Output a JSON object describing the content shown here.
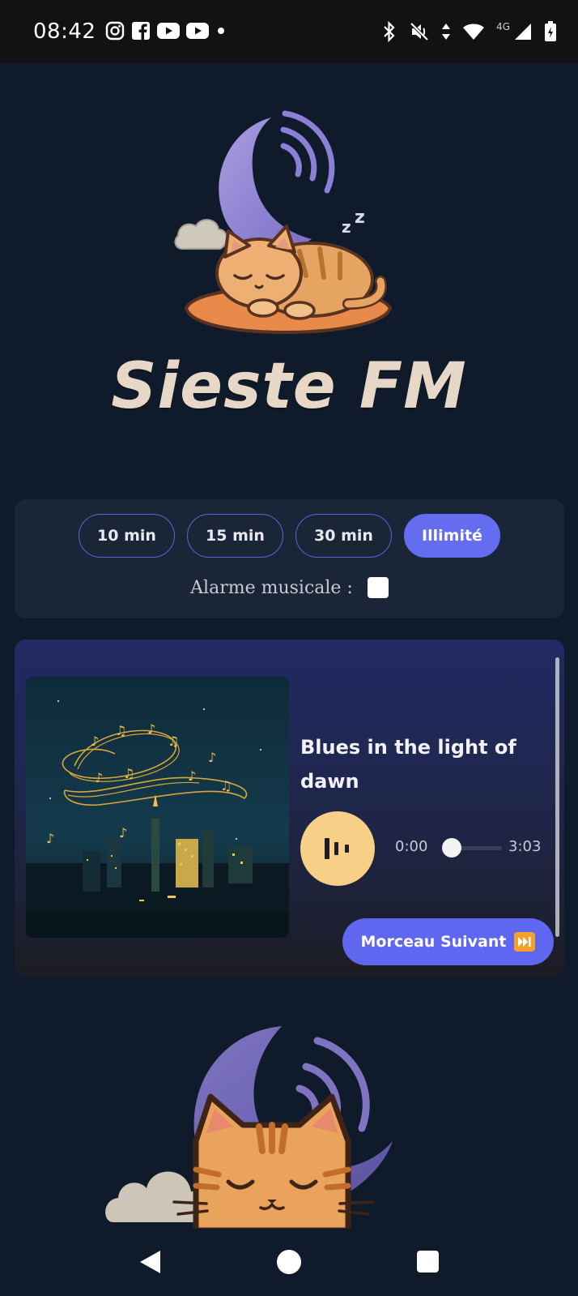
{
  "status_bar": {
    "time": "08:42",
    "left_icons": [
      "instagram-icon",
      "facebook-icon",
      "youtube-icon",
      "youtube-icon",
      "dot-icon"
    ],
    "right_icons": [
      "bluetooth-icon",
      "mute-icon",
      "data-arrows-icon",
      "wifi-icon",
      "cell-signal-icon",
      "battery-icon"
    ],
    "network_label": "4G"
  },
  "logo": {
    "title": "Sieste FM",
    "art": "sleeping-cat-moon-logo"
  },
  "timer": {
    "options": [
      {
        "label": "10 min",
        "active": false
      },
      {
        "label": "15 min",
        "active": false
      },
      {
        "label": "30 min",
        "active": false
      },
      {
        "label": "Illimité",
        "active": true
      }
    ],
    "alarm_label": "Alarme musicale :",
    "alarm_checked": false
  },
  "player": {
    "track_title": "Blues in the light of dawn",
    "time_current": "0:00",
    "time_total": "3:03",
    "progress": 0,
    "state": "playing",
    "next_label": "Morceau Suivant"
  },
  "colors": {
    "background": "#0f1a2b",
    "panel": "#1a2637",
    "accent": "#646cf0",
    "play_button": "#f7cf86",
    "title": "#e7d7c6"
  }
}
